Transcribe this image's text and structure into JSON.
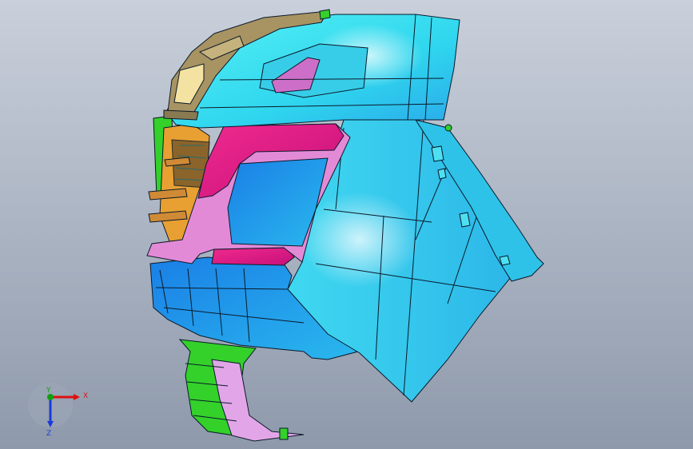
{
  "viewport": {
    "background_top": "#c9d0db",
    "background_bottom": "#8e99ab"
  },
  "model": {
    "colors": {
      "bumper_cyan": "#2fe6ee",
      "bumper_blue": "#1f8ee9",
      "lamp_tan": "#a89363",
      "pocket_pink": "#e01e82",
      "pocket_light_pink": "#e38ad7",
      "grille_orange": "#e8a032",
      "bracket_green": "#34d12a",
      "outline": "#0a1a2a"
    }
  },
  "triad": {
    "x_label": "X",
    "y_label": "Y",
    "z_label": "Z",
    "x_color": "#e01010",
    "y_color": "#10a010",
    "z_color": "#1a3ad8",
    "icons": {
      "x": "arrow-right-icon",
      "y": "arrow-up-icon",
      "z": "arrow-down-icon"
    }
  }
}
